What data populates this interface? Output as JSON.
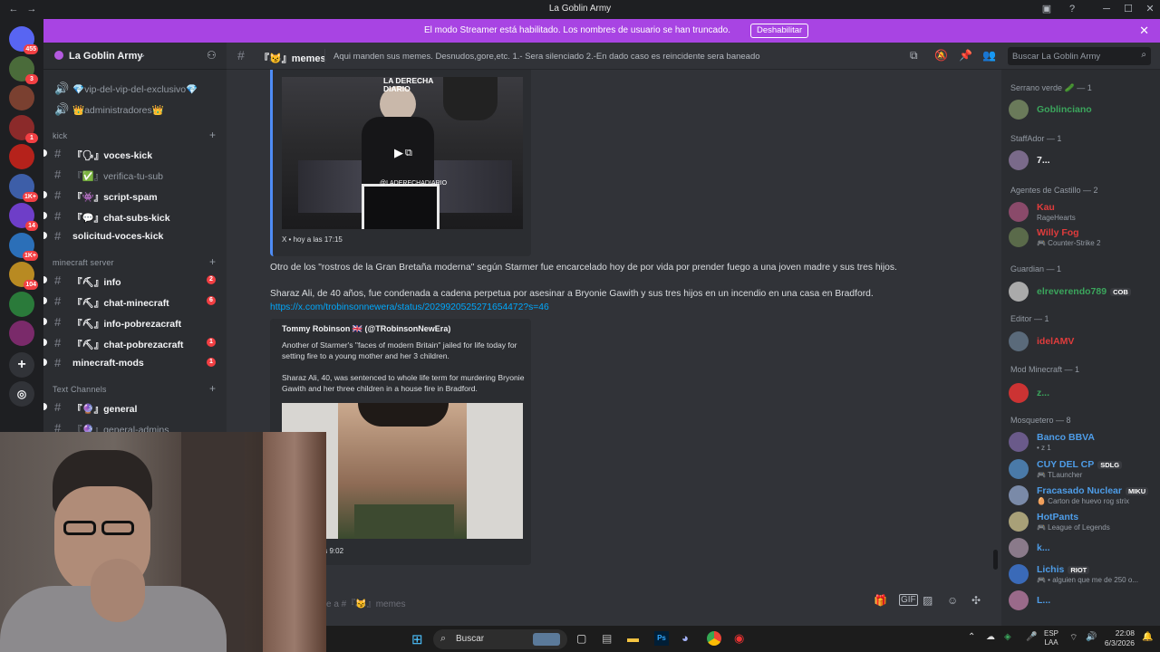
{
  "window": {
    "title": "La Goblin Army"
  },
  "servers": [
    {
      "badge": "455"
    },
    {
      "badge": "3"
    },
    {
      "badge": ""
    },
    {
      "badge": "1"
    },
    {
      "badge": ""
    },
    {
      "badge": "1K+"
    },
    {
      "badge": "14"
    },
    {
      "badge": "1K+"
    },
    {
      "badge": "104"
    },
    {
      "badge": ""
    },
    {
      "badge": ""
    }
  ],
  "banner": {
    "text": "El modo Streamer está habilitado. Los nombres de usuario se han truncado.",
    "button": "Deshabilitar"
  },
  "guild": {
    "name": "La Goblin Army"
  },
  "channels": [
    {
      "label": "💎vip-del-vip-del-exclusivo💎",
      "unread": false,
      "count": ""
    },
    {
      "label": "👑administradores👑",
      "unread": false,
      "count": ""
    },
    {
      "cat": "kick"
    },
    {
      "label": "『🗣』voces-kick",
      "unread": true,
      "count": ""
    },
    {
      "label": "『✅』verifica-tu-sub",
      "unread": false,
      "count": ""
    },
    {
      "label": "『👾』script-spam",
      "unread": true,
      "count": ""
    },
    {
      "label": "『💬』chat-subs-kick",
      "unread": true,
      "count": ""
    },
    {
      "label": "solicitud-voces-kick",
      "unread": true,
      "count": ""
    },
    {
      "cat": "minecraft server"
    },
    {
      "label": "『⛏』info",
      "unread": true,
      "count": "2"
    },
    {
      "label": "『⛏』chat-minecraft",
      "unread": true,
      "count": "6"
    },
    {
      "label": "『⛏』info-pobrezacraft",
      "unread": true,
      "count": ""
    },
    {
      "label": "『⛏』chat-pobrezacraft",
      "unread": true,
      "count": "1"
    },
    {
      "label": "minecraft-mods",
      "unread": true,
      "count": "1"
    },
    {
      "cat": "Text Channels"
    },
    {
      "label": "『🔮』general",
      "unread": true,
      "count": ""
    },
    {
      "label": "『🔮』general-admins",
      "unread": false,
      "count": ""
    }
  ],
  "header": {
    "channel": "『😼』memes",
    "topic": "Aqui manden sus memes. Desnudos,gore,etc. 1.- Sera silenciado 2.-En dado caso es reincidente sera baneado",
    "search_placeholder": "Buscar La Goblin Army"
  },
  "embed1": {
    "watermark": "LA DERECHA DIARIO",
    "source": "@LADERECHADIARIO",
    "footer": "X • hoy a las 17:15"
  },
  "messages": {
    "m1": "Otro de los \"rostros de la Gran Bretaña moderna\" según Starmer fue encarcelado hoy de por vida por prender fuego a una joven madre y sus tres hijos.",
    "m2": "Sharaz Ali, de 40 años, fue condenada a cadena perpetua por asesinar a Bryonie Gawith y sus tres hijos en un incendio en una casa en Bradford.",
    "link": "https://x.com/trobinsonnewera/status/2029920525271654472?s=46"
  },
  "embed2": {
    "author": "Tommy Robinson 🇬🇧 (@TRobinsonNewEra)",
    "p1": "Another of Starmer's \"faces of modern Britain\" jailed for life today for setting fire to a young mother and her 3 children.",
    "p2": "Sharaz Ali, 40, was sentenced to whole life term for murdering Bryonie Gawith and her three children in a house fire in Bradford.",
    "footer": "las 9:02"
  },
  "composer": {
    "placeholder": "e a #『😼』memes"
  },
  "members": [
    {
      "cat": "Serrano verde 🥒 — 1"
    },
    {
      "name": "Goblinciano",
      "color": "#3ba55c",
      "status": "",
      "tag": ""
    },
    {
      "cat": "StaffAdor — 1"
    },
    {
      "name": "7...",
      "color": "#f2f3f5",
      "status": "",
      "tag": ""
    },
    {
      "cat": "Agentes de Castillo — 2"
    },
    {
      "name": "Kau",
      "color": "#e03c3c",
      "status": "RageHearts",
      "tag": ""
    },
    {
      "name": "Willy Fog",
      "color": "#e03c3c",
      "status": "🎮 Counter-Strike 2",
      "tag": ""
    },
    {
      "cat": "Guardian — 1"
    },
    {
      "name": "elreverendo789",
      "color": "#3ba55c",
      "status": "",
      "tag": "COB"
    },
    {
      "cat": "Editor — 1"
    },
    {
      "name": "idelAMV",
      "color": "#e03c3c",
      "status": "",
      "tag": ""
    },
    {
      "cat": "Mod Minecraft — 1"
    },
    {
      "name": "z...",
      "color": "#3ba55c",
      "status": "",
      "tag": ""
    },
    {
      "cat": "Mosquetero — 8"
    },
    {
      "name": "Banco BBVA",
      "color": "#4e9de8",
      "status": "• z 1",
      "tag": ""
    },
    {
      "name": "CUY DEL CP",
      "color": "#4e9de8",
      "status": "🎮 TLauncher",
      "tag": "SDLG"
    },
    {
      "name": "Fracasado Nuclear",
      "color": "#4e9de8",
      "status": "🥚 Carton de huevo rog strix",
      "tag": "MIKU"
    },
    {
      "name": "HotPants",
      "color": "#4e9de8",
      "status": "🎮 League of Legends",
      "tag": ""
    },
    {
      "name": "k...",
      "color": "#4e9de8",
      "status": "",
      "tag": ""
    },
    {
      "name": "Lichis",
      "color": "#4e9de8",
      "status": "🎮 • alguien que me de 250 o...",
      "tag": "RIOT"
    },
    {
      "name": "L...",
      "color": "#4e9de8",
      "status": "",
      "tag": ""
    }
  ],
  "taskbar": {
    "search": "Buscar",
    "lang": "ESP",
    "lang2": "LAA",
    "time": "22:08",
    "date": "6/3/2026"
  }
}
